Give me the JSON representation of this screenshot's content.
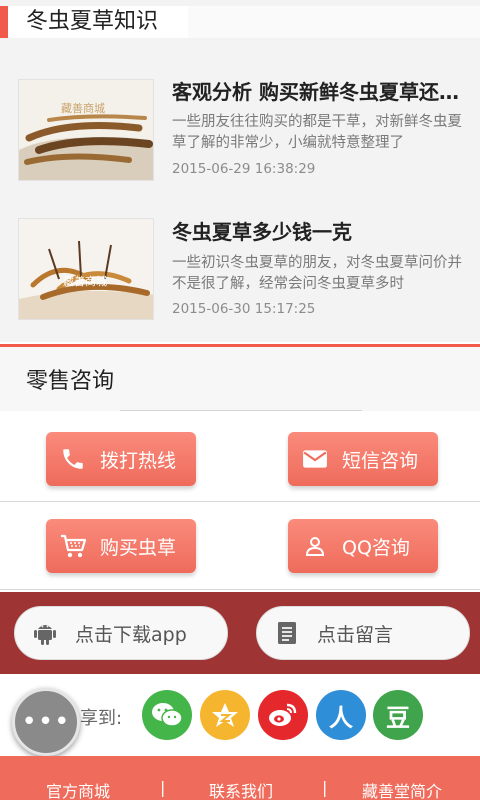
{
  "section": {
    "title": "冬虫夏草知识"
  },
  "articles": [
    {
      "title": "客观分析 购买新鲜冬虫夏草还是干草",
      "desc": "一些朋友往往购买的都是干草，对新鲜冬虫夏草了解的非常少，小编就特意整理了",
      "date": "2015-06-29 16:38:29",
      "watermark": "藏善商城"
    },
    {
      "title": "冬虫夏草多少钱一克",
      "desc": "一些初识冬虫夏草的朋友，对冬虫夏草问价并不是很了解，经常会问冬虫夏草多时",
      "date": "2015-06-30 15:17:25",
      "watermark": "藏善商城"
    }
  ],
  "consult": {
    "title": "零售咨询",
    "call": "拨打热线",
    "sms": "短信咨询",
    "buy": "购买虫草",
    "qq": "QQ咨询"
  },
  "download": {
    "app": "点击下载app",
    "message": "点击留言"
  },
  "share": {
    "label": "分享到:",
    "icons": [
      "wechat-icon",
      "qzone-icon",
      "weibo-icon",
      "renren-icon",
      "douban-icon"
    ],
    "renren": "人",
    "douban": "豆"
  },
  "fab": {
    "label": "•••"
  },
  "footer": {
    "shop": "官方商城",
    "sep": "|",
    "contact": "联系我们",
    "about": "藏善堂简介"
  },
  "colors": {
    "accent": "#f15a4a",
    "button": "#ef6b5b",
    "band": "#9e3434"
  }
}
